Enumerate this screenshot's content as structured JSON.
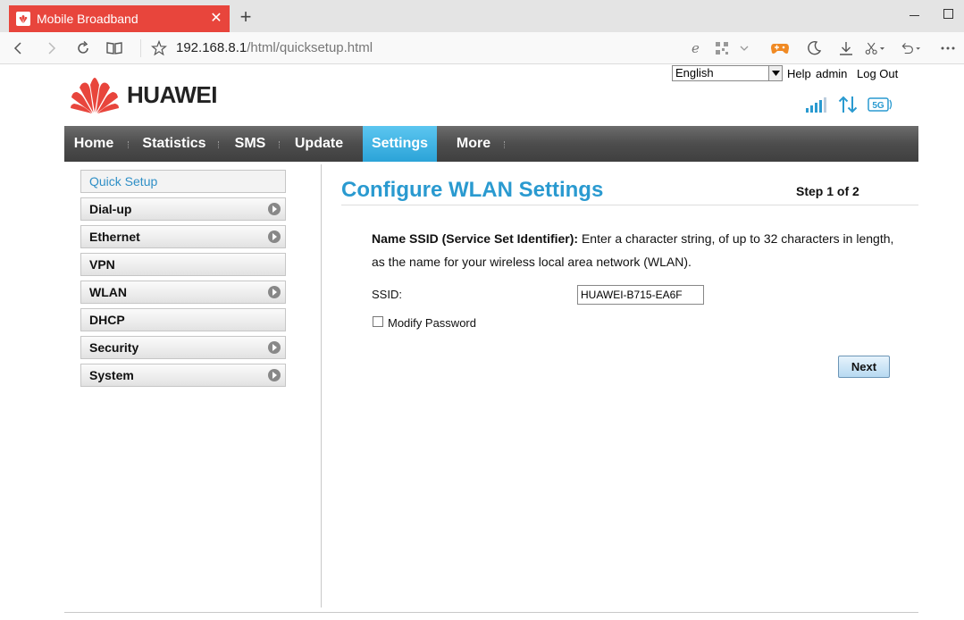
{
  "browser": {
    "tab_title": "Mobile Broadband",
    "tab_close": "✕",
    "new_tab": "+",
    "url_host": "192.168.8.1",
    "url_path": "/html/quicksetup.html",
    "icons": [
      "back-icon",
      "forward-icon",
      "reload-icon",
      "reader-icon",
      "star-icon",
      "ie-icon",
      "qr-icon",
      "chevron-down-icon",
      "game-icon",
      "moon-icon",
      "download-icon",
      "scissors-icon",
      "undo-icon",
      "more-icon"
    ]
  },
  "header": {
    "language": "English",
    "links": {
      "help": "Help",
      "user": "admin",
      "logout": "Log Out"
    },
    "brand": "HUAWEI",
    "status_icons": [
      "signal-icon",
      "transfer-arrows-icon",
      "5g-icon"
    ],
    "badge_5g": "5G",
    "accent_color": "#2a9ad0",
    "brand_color": "#e8453c"
  },
  "nav": {
    "items": [
      {
        "label": "Home"
      },
      {
        "label": "Statistics"
      },
      {
        "label": "SMS"
      },
      {
        "label": "Update"
      },
      {
        "label": "Settings",
        "active": true
      },
      {
        "label": "More"
      }
    ]
  },
  "sidebar": {
    "items": [
      {
        "label": "Quick Setup",
        "active": true,
        "expandable": false
      },
      {
        "label": "Dial-up",
        "expandable": true
      },
      {
        "label": "Ethernet",
        "expandable": true
      },
      {
        "label": "VPN",
        "expandable": false
      },
      {
        "label": "WLAN",
        "expandable": true
      },
      {
        "label": "DHCP",
        "expandable": false
      },
      {
        "label": "Security",
        "expandable": true
      },
      {
        "label": "System",
        "expandable": true
      }
    ]
  },
  "main": {
    "title": "Configure WLAN Settings",
    "step": "Step 1 of 2",
    "desc_bold": "Name SSID (Service Set Identifier):",
    "desc_text": " Enter a character string, of up to 32 characters in length, as the name for your wireless local area network (WLAN).",
    "ssid_label": "SSID:",
    "ssid_value": "HUAWEI-B715-EA6F",
    "modify_password_label": "Modify Password",
    "modify_password_checked": false,
    "next_label": "Next"
  }
}
